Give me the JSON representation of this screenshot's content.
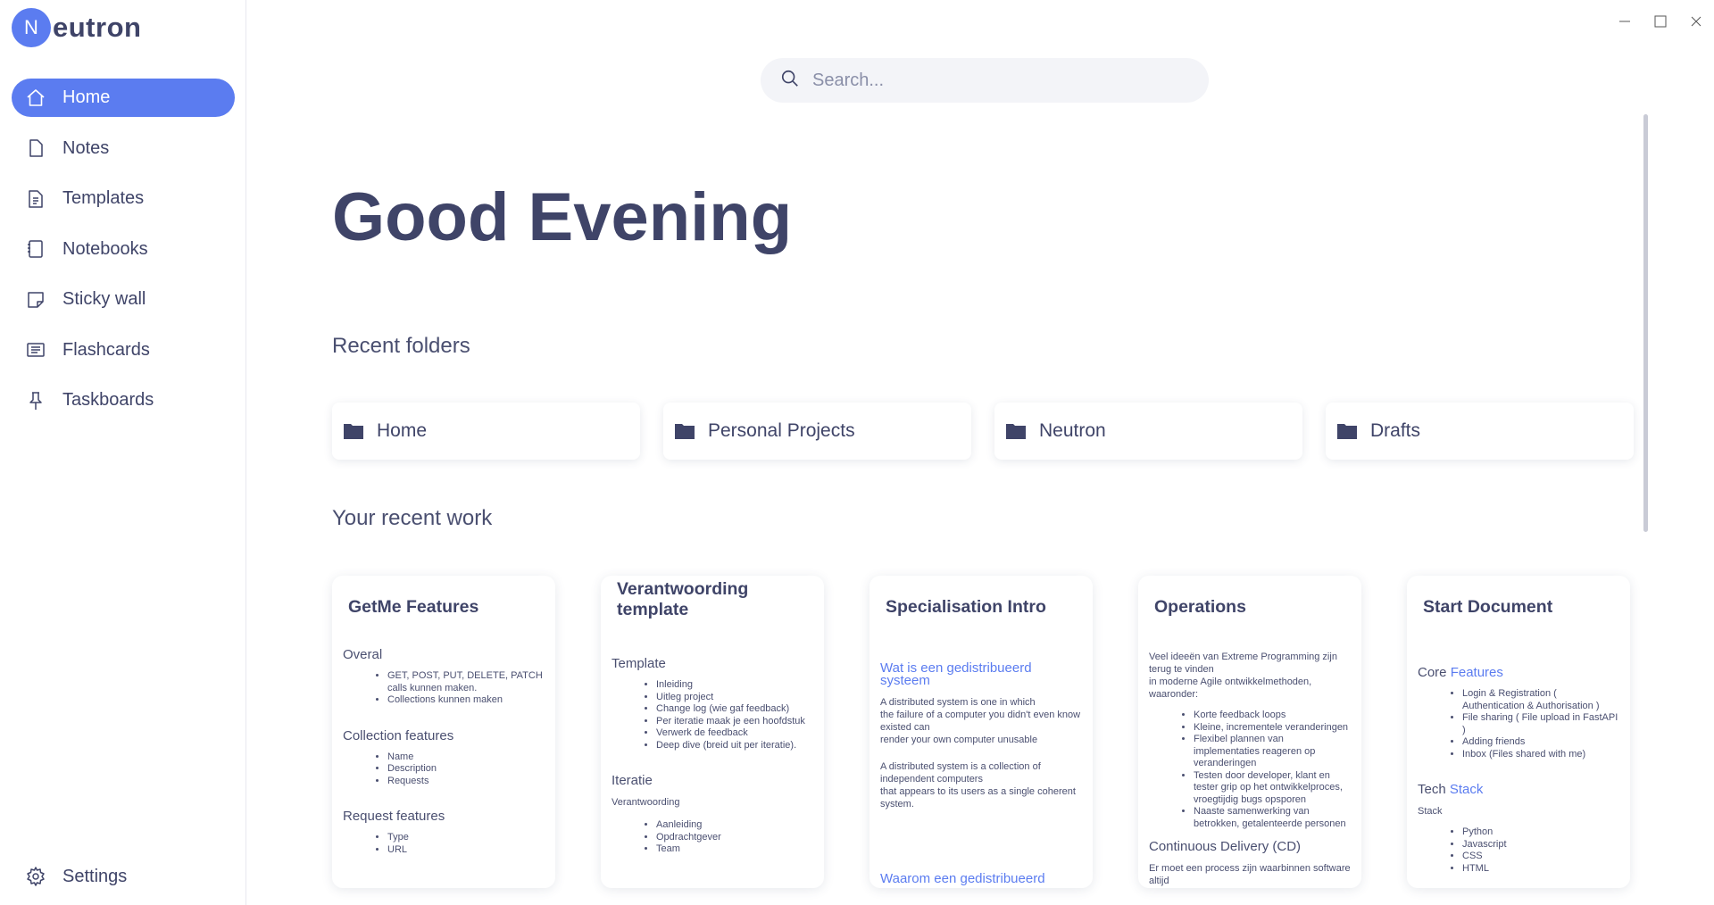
{
  "app": {
    "logo_letter": "N",
    "logo_rest": "eutron",
    "accent": "#5b7cf0"
  },
  "sidebar": {
    "items": [
      {
        "label": "Home",
        "icon": "home-icon",
        "active": true
      },
      {
        "label": "Notes",
        "icon": "note-icon"
      },
      {
        "label": "Templates",
        "icon": "template-icon"
      },
      {
        "label": "Notebooks",
        "icon": "notebook-icon"
      },
      {
        "label": "Sticky wall",
        "icon": "sticky-note-icon"
      },
      {
        "label": "Flashcards",
        "icon": "flashcard-icon"
      },
      {
        "label": "Taskboards",
        "icon": "pin-icon"
      }
    ],
    "settings_label": "Settings"
  },
  "search": {
    "placeholder": "Search..."
  },
  "greeting": "Good Evening",
  "recent_folders": {
    "title": "Recent folders",
    "items": [
      "Home",
      "Personal Projects",
      "Neutron",
      "Drafts"
    ]
  },
  "recent_work": {
    "title": "Your recent work",
    "cards": [
      {
        "title": "GetMe Features",
        "h1": "Overal",
        "l1": [
          "GET, POST, PUT, DELETE, PATCH calls kunnen maken.",
          "Collections kunnen maken"
        ],
        "h2": "Collection features",
        "l2": [
          "Name",
          "Description",
          "Requests"
        ],
        "h3": "Request features",
        "l3": [
          "Type",
          "URL"
        ]
      },
      {
        "title": "Verantwoording template",
        "h1": "Template",
        "l1": [
          "Inleiding",
          "Uitleg project",
          "Change log (wie gaf feedback)",
          "Per iteratie maak je een hoofdstuk",
          "Verwerk de feedback",
          "Deep dive (breid uit per iteratie)."
        ],
        "h2": "Iteratie",
        "p1": "Verantwoording",
        "l2": [
          "Aanleiding",
          "Opdrachtgever",
          "Team"
        ]
      },
      {
        "title": "Specialisation Intro",
        "link1": "Wat is een gedistribueerd systeem",
        "p1": "A distributed system is one in which",
        "p2": "the failure of a computer you didn't even know existed can",
        "p3": "render your own computer unusable",
        "p4": "A distributed system is a collection of independent computers",
        "p5": "that appears to its users as a single coherent system.",
        "link2": "Waarom een gedistribueerd"
      },
      {
        "title": "Operations",
        "p1": "Veel ideeën van Extreme Programming zijn terug te vinden",
        "p2": "in moderne Agile ontwikkelmethoden, waaronder:",
        "l1": [
          "Korte feedback loops",
          "Kleine, incrementele veranderingen",
          "Flexibel plannen van implementaties reageren op veranderingen",
          "Testen door developer, klant en tester grip op het ontwikkelproces, vroegtijdig bugs opsporen",
          "Naaste samenwerking van betrokken, getalenteerde personen"
        ],
        "h1": "Continuous Delivery (CD)",
        "p3": "Er moet een process zijn waarbinnen software altijd"
      },
      {
        "title": "Start Document",
        "h1a": "Core ",
        "h1b": "Features",
        "l1": [
          "Login & Registration ( Authentication & Authorisation )",
          "File sharing ( File upload in FastAPI )",
          "Adding friends",
          "Inbox (Files shared with me)"
        ],
        "h2a": "Tech ",
        "h2b": "Stack",
        "p1": "Stack",
        "l2": [
          "Python",
          "Javascript",
          "CSS",
          "HTML"
        ]
      }
    ]
  }
}
